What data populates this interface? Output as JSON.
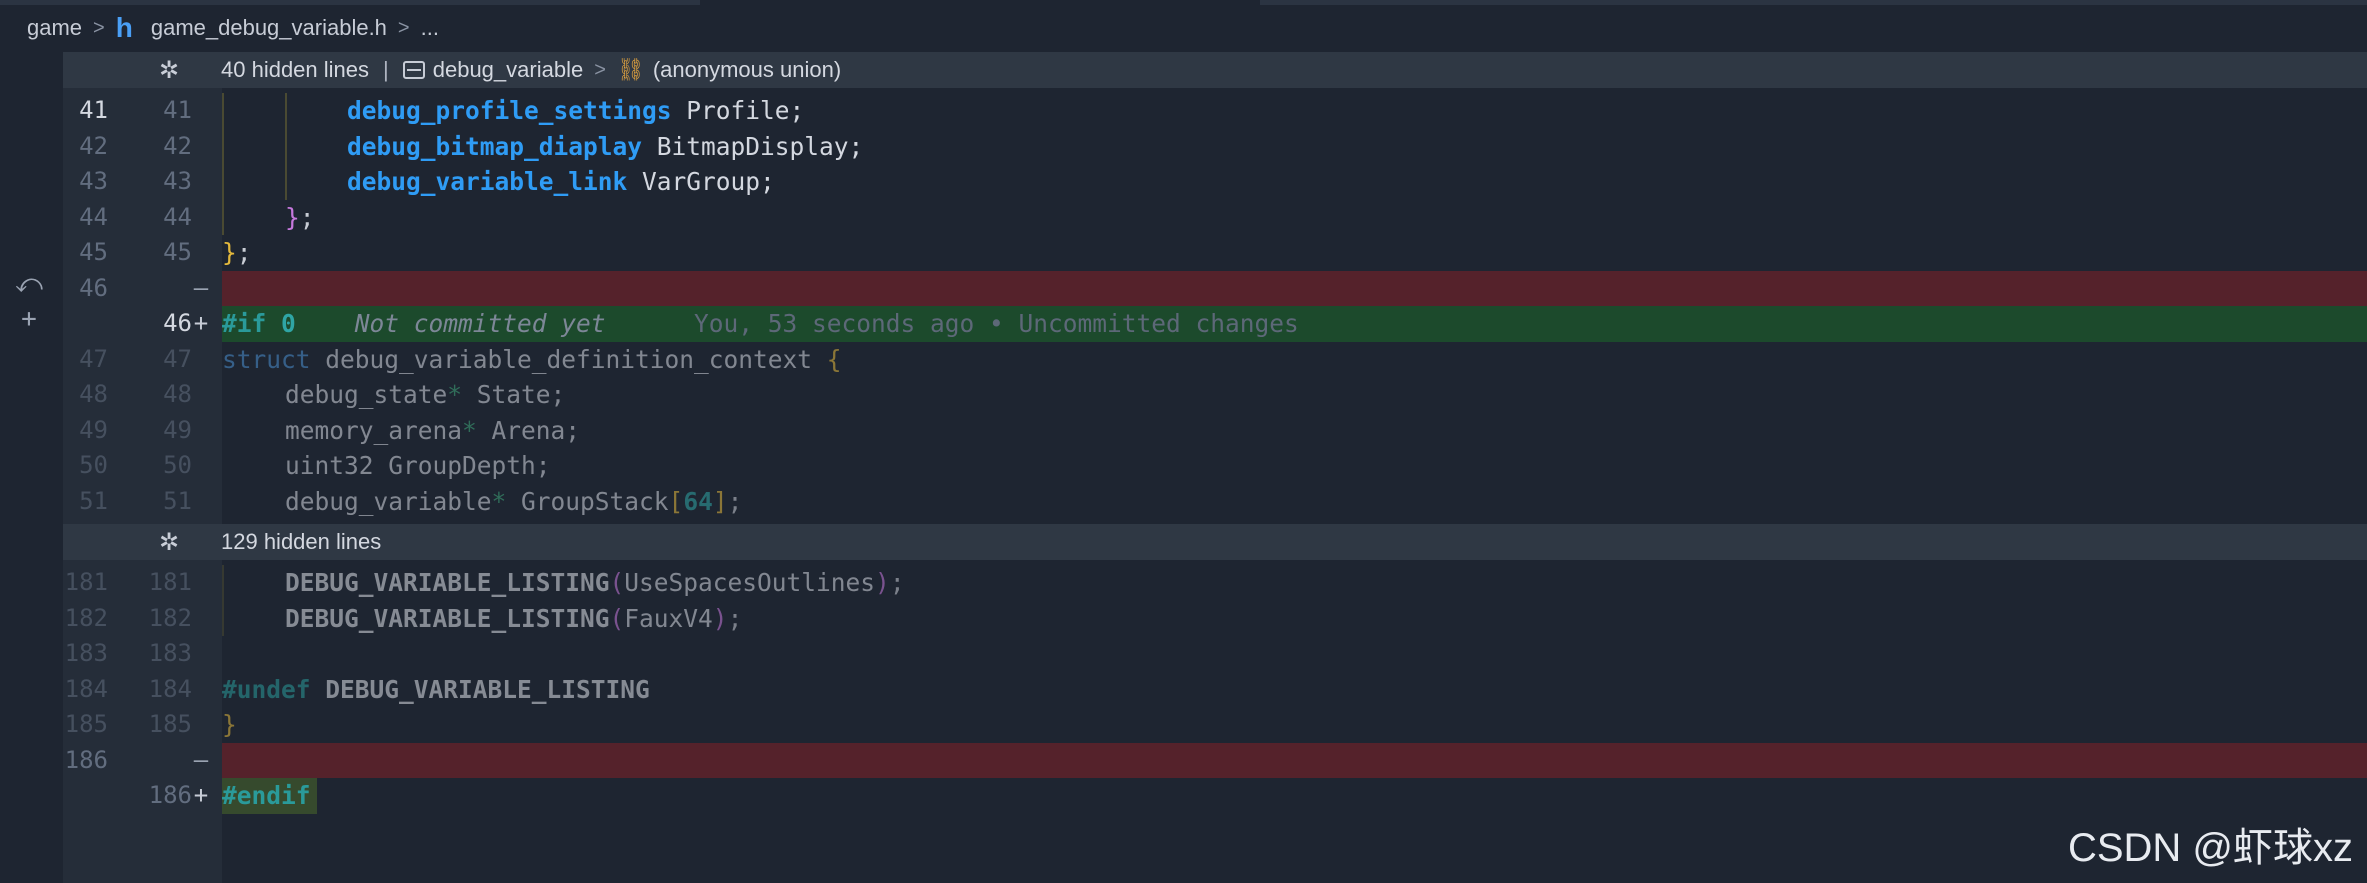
{
  "breadcrumb": {
    "folder": "game",
    "file_icon": "h",
    "file": "game_debug_variable.h",
    "more": "..."
  },
  "folds": [
    {
      "hidden_text": "40 hidden lines",
      "symbol_1": "debug_variable",
      "symbol_2": "(anonymous union)"
    },
    {
      "hidden_text": "129 hidden lines"
    }
  ],
  "lines": [
    {
      "left": "41",
      "right": "41",
      "kind": "ctx",
      "active": true
    },
    {
      "left": "42",
      "right": "42",
      "kind": "ctx"
    },
    {
      "left": "43",
      "right": "43",
      "kind": "ctx"
    },
    {
      "left": "44",
      "right": "44",
      "kind": "ctx"
    },
    {
      "left": "45",
      "right": "45",
      "kind": "ctx"
    },
    {
      "left": "46",
      "right": "",
      "kind": "del",
      "marker": "—"
    },
    {
      "left": "",
      "right": "46",
      "kind": "add",
      "marker": "+",
      "active": true
    },
    {
      "left": "47",
      "right": "47",
      "kind": "ctx"
    },
    {
      "left": "48",
      "right": "48",
      "kind": "ctx"
    },
    {
      "left": "49",
      "right": "49",
      "kind": "ctx"
    },
    {
      "left": "50",
      "right": "50",
      "kind": "ctx"
    },
    {
      "left": "51",
      "right": "51",
      "kind": "ctx"
    },
    {
      "left": "181",
      "right": "181",
      "kind": "ctx"
    },
    {
      "left": "182",
      "right": "182",
      "kind": "ctx"
    },
    {
      "left": "183",
      "right": "183",
      "kind": "ctx"
    },
    {
      "left": "184",
      "right": "184",
      "kind": "ctx"
    },
    {
      "left": "185",
      "right": "185",
      "kind": "ctx"
    },
    {
      "left": "186",
      "right": "",
      "kind": "del",
      "marker": "—"
    },
    {
      "left": "",
      "right": "186",
      "kind": "add",
      "marker": "+"
    }
  ],
  "code": {
    "l41_type": "debug_profile_settings",
    "l41_id": " Profile;",
    "l42_type": "debug_bitmap_diaplay",
    "l42_id": " BitmapDisplay;",
    "l43_type": "debug_variable_link",
    "l43_id": " VarGroup;",
    "l44_brace": "}",
    "l44_semi": ";",
    "l45_brace": "}",
    "l45_semi": ";",
    "l46_pre": "#if",
    "l46_num": " 0",
    "l46_comment": "    Not committed yet",
    "l46_blame": "      You, 53 seconds ago • Uncommitted changes",
    "l47_kw": "struct",
    "l47_id": " debug_variable_definition_context ",
    "l47_brace": "{",
    "l48_a": "debug_state",
    "l48_star": "*",
    "l48_b": " State;",
    "l49_a": "memory_arena",
    "l49_star": "*",
    "l49_b": " Arena;",
    "l50_a": "uint32 GroupDepth;",
    "l51_a": "debug_variable",
    "l51_star": "*",
    "l51_b": " GroupStack",
    "l51_br1": "[",
    "l51_num": "64",
    "l51_br2": "]",
    "l51_semi": ";",
    "l181_macro": "DEBUG_VARIABLE_LISTING",
    "l181_p1": "(",
    "l181_arg": "UseSpacesOutlines",
    "l181_p2": ")",
    "l181_semi": ";",
    "l182_macro": "DEBUG_VARIABLE_LISTING",
    "l182_p1": "(",
    "l182_arg": "FauxV4",
    "l182_p2": ")",
    "l182_semi": ";",
    "l184_pre": "#undef",
    "l184_macro": " DEBUG_VARIABLE_LISTING",
    "l185_brace": "}",
    "l186_pre": "#endif"
  },
  "watermark": "CSDN @虾球xz",
  "colors": {
    "background": "#1e2531",
    "deleted_line": "#55222b",
    "added_line": "#1c4a2c",
    "type_accent": "#2f9cf5"
  }
}
